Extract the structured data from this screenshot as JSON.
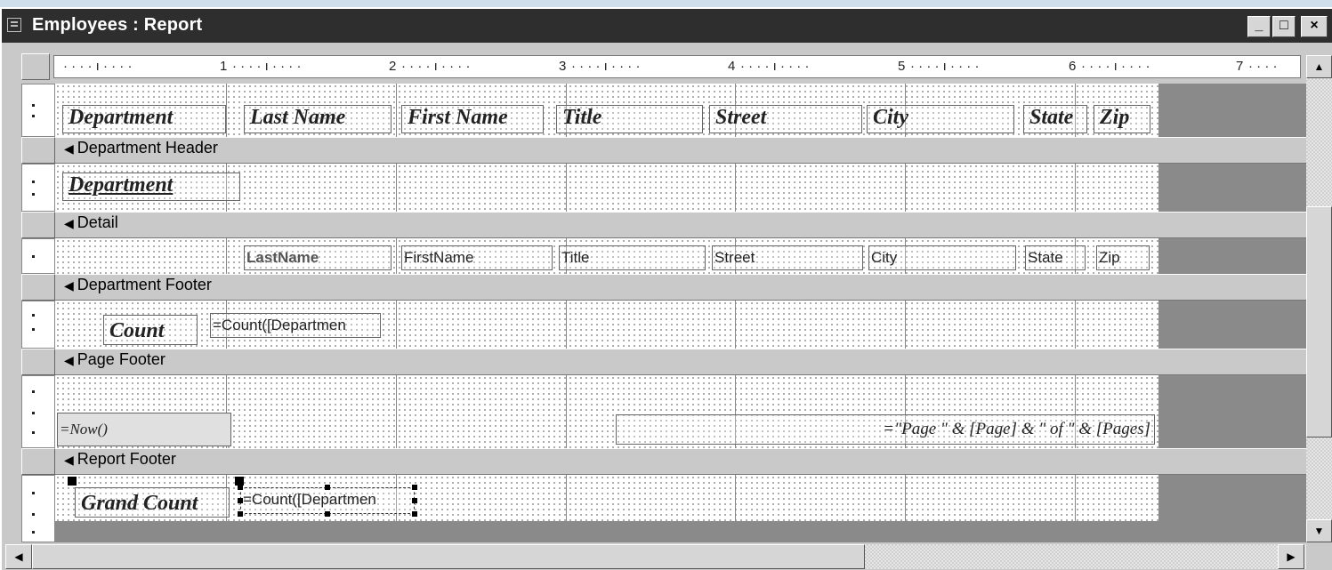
{
  "window": {
    "title": "Employees : Report",
    "min_glyph": "_",
    "max_glyph": "□",
    "close_glyph": "×"
  },
  "ruler": {
    "labels": [
      "1",
      "2",
      "3",
      "4",
      "5",
      "6",
      "7"
    ]
  },
  "scroll": {
    "up_glyph": "▲",
    "down_glyph": "▼",
    "left_glyph": "◀",
    "right_glyph": "▶"
  },
  "page_header": {
    "labels": [
      "Department",
      "Last Name",
      "First Name",
      "Title",
      "Street",
      "City",
      "State",
      "Zip"
    ]
  },
  "bands": {
    "department_header": "Department Header",
    "detail": "Detail",
    "department_footer": "Department Footer",
    "page_footer": "Page Footer",
    "report_footer": "Report Footer"
  },
  "department_header": {
    "field": "Department"
  },
  "detail": {
    "fields": [
      "LastName",
      "FirstName",
      "Title",
      "Street",
      "City",
      "State",
      "Zip"
    ]
  },
  "department_footer": {
    "label": "Count",
    "expr": "=Count([Departmen"
  },
  "page_footer": {
    "now": "=Now()",
    "page_expr": "=\"Page \" & [Page] & \" of \" & [Pages]"
  },
  "report_footer": {
    "label": "Grand Count",
    "expr": "=Count([Departmen"
  },
  "colors": {
    "titlebar": "#2e2e2e",
    "band": "#c9c9c9",
    "canvas_bg": "#8a8a8a"
  }
}
